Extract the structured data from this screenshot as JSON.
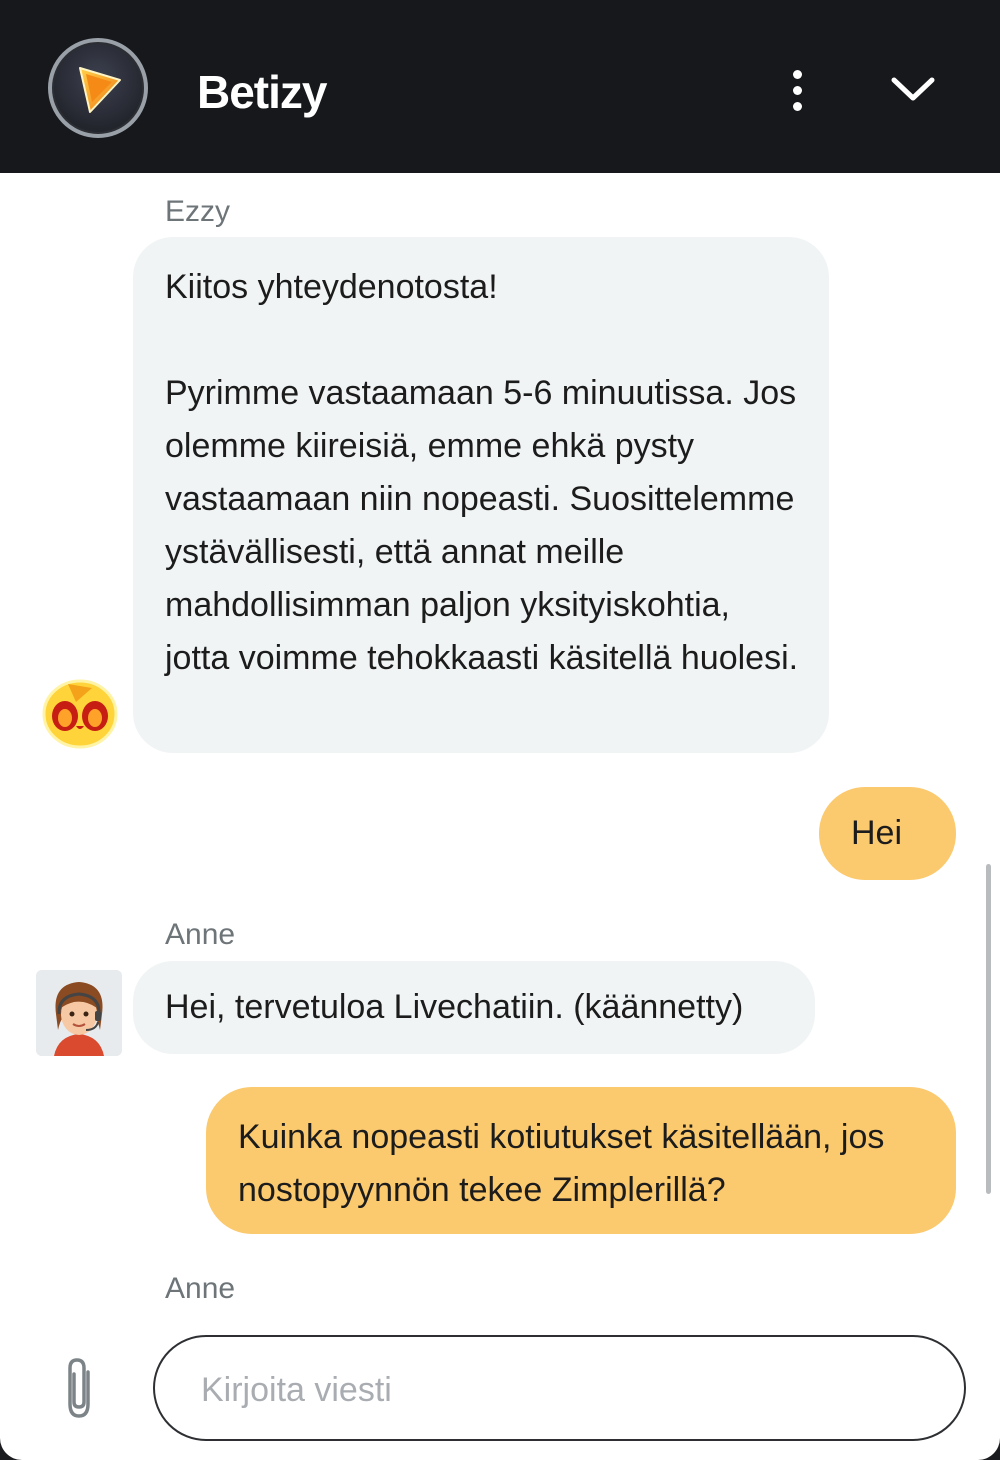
{
  "header": {
    "title": "Betizy",
    "logo_icon": "play-triangle-logo-icon",
    "menu_icon": "more-vertical-icon",
    "collapse_icon": "chevron-down-icon"
  },
  "messages": [
    {
      "sender": "Ezzy",
      "direction": "incoming",
      "text": "Kiitos yhteydenotosta!\n\nPyrimme vastaamaan 5-6 minuutissa. Jos olemme kiireisiä, emme ehkä pysty vastaamaan niin nopeasti. Suosittelemme ystävällisesti, että annat meille mahdollisimman paljon yksityiskohtia, jotta voimme tehokkaasti käsitellä huolesi."
    },
    {
      "direction": "outgoing",
      "text": "Hei"
    },
    {
      "sender": "Anne",
      "direction": "incoming",
      "text": "Hei, tervetuloa Livechatiin. (käännetty)"
    },
    {
      "direction": "outgoing",
      "text": "Kuinka nopeasti kotiutukset käsitellään, jos nostopyynnön tekee Zimplerillä?"
    },
    {
      "sender": "Anne",
      "direction": "incoming",
      "text": ""
    }
  ],
  "composer": {
    "placeholder": "Kirjoita viesti",
    "value": "",
    "attach_icon": "paperclip-icon"
  },
  "colors": {
    "header_bg": "#17181c",
    "incoming_bubble": "#f1f4f5",
    "outgoing_bubble": "#fbc96e",
    "accent": "#f7a21b"
  }
}
